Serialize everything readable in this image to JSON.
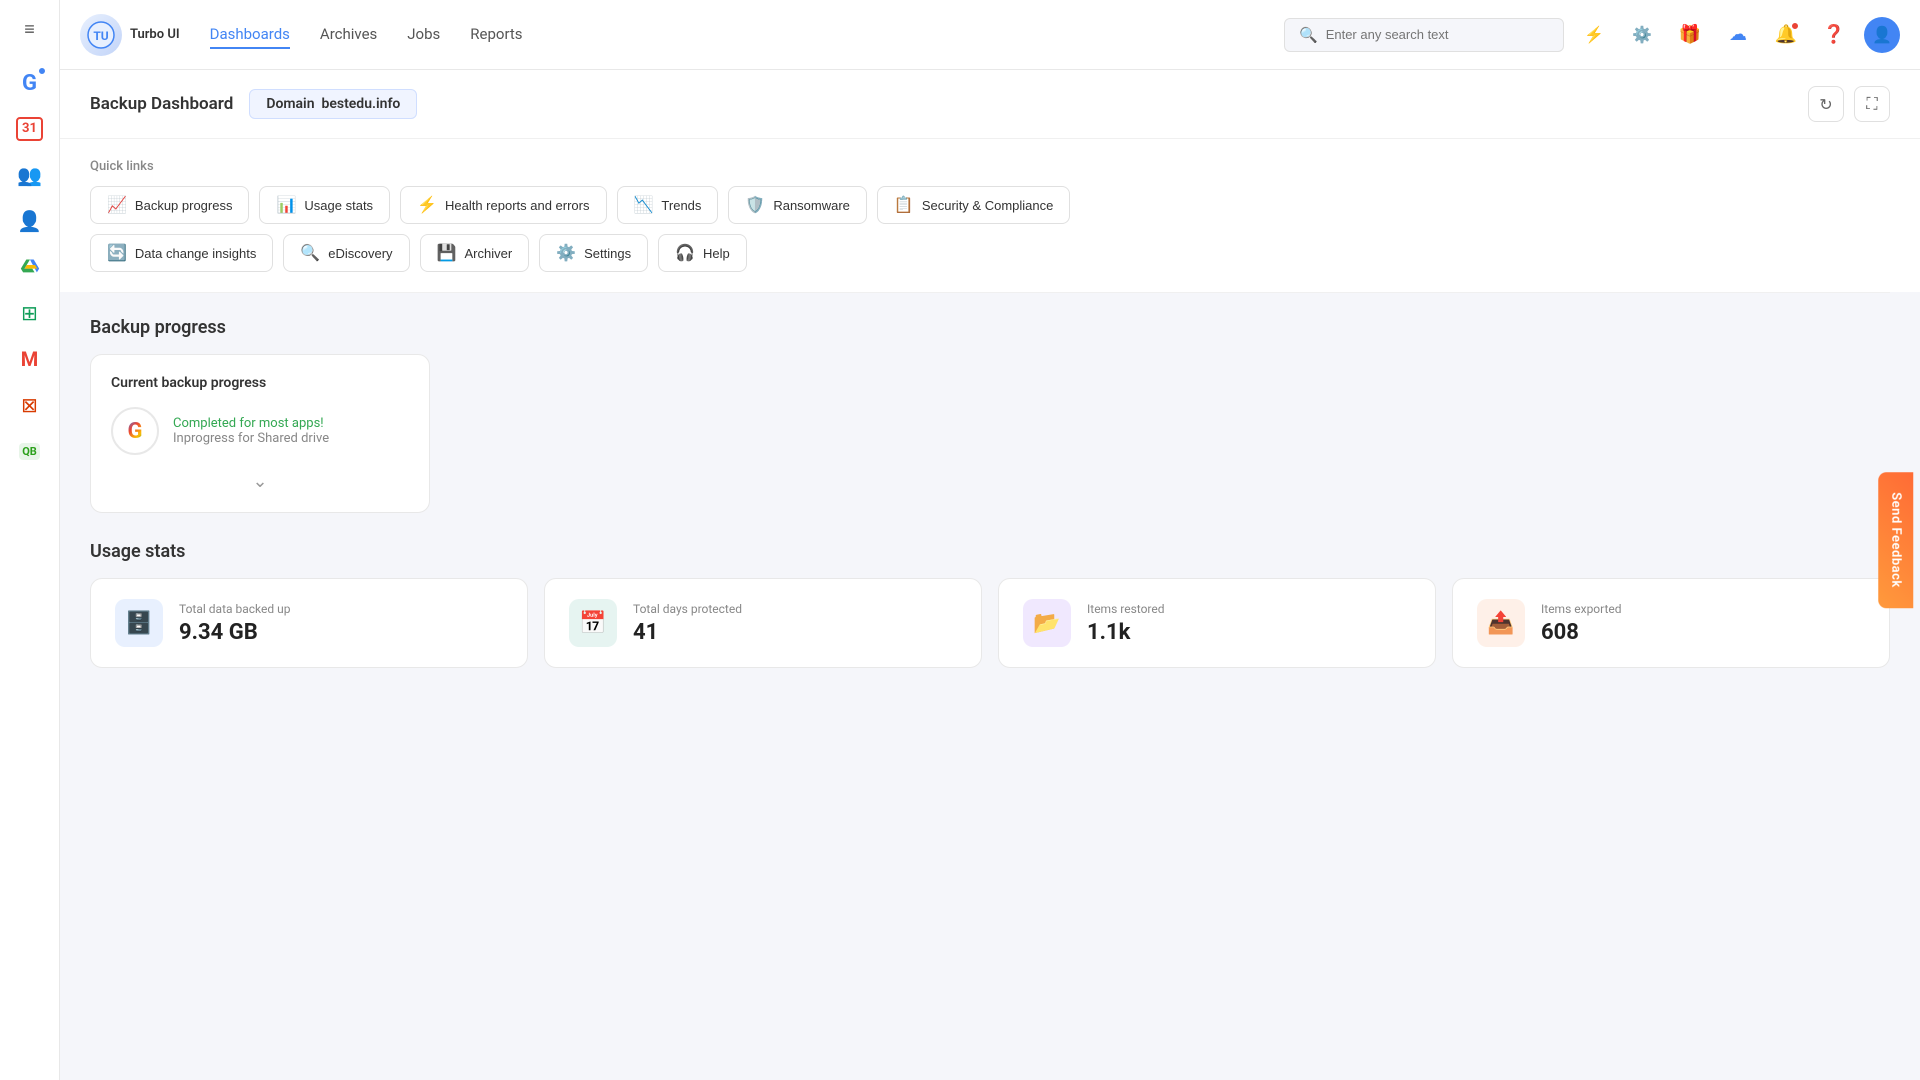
{
  "app": {
    "name": "Turbo UI"
  },
  "navbar": {
    "links": [
      {
        "id": "dashboards",
        "label": "Dashboards",
        "active": true
      },
      {
        "id": "archives",
        "label": "Archives",
        "active": false
      },
      {
        "id": "jobs",
        "label": "Jobs",
        "active": false
      },
      {
        "id": "reports",
        "label": "Reports",
        "active": false
      }
    ],
    "search_placeholder": "Enter any search text"
  },
  "page_header": {
    "title": "Backup Dashboard",
    "domain_label": "Domain",
    "domain_value": "bestedu.info"
  },
  "quick_links": {
    "label": "Quick links",
    "row1": [
      {
        "id": "backup-progress",
        "label": "Backup progress",
        "icon": "📈"
      },
      {
        "id": "usage-stats",
        "label": "Usage stats",
        "icon": "📊"
      },
      {
        "id": "health-reports",
        "label": "Health reports and errors",
        "icon": "⚡"
      },
      {
        "id": "trends",
        "label": "Trends",
        "icon": "📉"
      },
      {
        "id": "ransomware",
        "label": "Ransomware",
        "icon": "🛡️"
      },
      {
        "id": "security",
        "label": "Security & Compliance",
        "icon": "📋"
      }
    ],
    "row2": [
      {
        "id": "data-change",
        "label": "Data change insights",
        "icon": "🔄"
      },
      {
        "id": "ediscovery",
        "label": "eDiscovery",
        "icon": "🔍"
      },
      {
        "id": "archiver",
        "label": "Archiver",
        "icon": "💾"
      },
      {
        "id": "settings",
        "label": "Settings",
        "icon": "⚙️"
      },
      {
        "id": "help",
        "label": "Help",
        "icon": "🎧"
      }
    ]
  },
  "backup_progress": {
    "section_title": "Backup progress",
    "card_title": "Current backup progress",
    "apps": [
      {
        "name": "Google",
        "icon": "G",
        "status_completed": "Completed for most apps!",
        "status_inprogress": "Inprogress for Shared drive"
      }
    ]
  },
  "usage_stats": {
    "section_title": "Usage stats",
    "cards": [
      {
        "id": "total-data",
        "label": "Total data backed up",
        "value": "9.34 GB",
        "icon": "🗄️",
        "color": "blue"
      },
      {
        "id": "days-protected",
        "label": "Total days protected",
        "value": "41",
        "icon": "📅",
        "color": "teal"
      },
      {
        "id": "items-restored",
        "label": "Items restored",
        "value": "1.1k",
        "icon": "📂",
        "color": "purple"
      },
      {
        "id": "items-exported",
        "label": "Items exported",
        "value": "608",
        "icon": "📤",
        "color": "orange"
      }
    ]
  },
  "feedback": {
    "label": "Send Feedback"
  },
  "sidebar": {
    "items": [
      {
        "id": "menu",
        "icon": "≡",
        "label": "Menu"
      },
      {
        "id": "google",
        "icon": "G",
        "label": "Google",
        "badge": true
      },
      {
        "id": "calendar",
        "icon": "31",
        "label": "Calendar"
      },
      {
        "id": "contacts",
        "icon": "👥",
        "label": "Contacts"
      },
      {
        "id": "user",
        "icon": "👤",
        "label": "User"
      },
      {
        "id": "drive",
        "icon": "△",
        "label": "Drive"
      },
      {
        "id": "sheets",
        "icon": "⊞",
        "label": "Sheets"
      },
      {
        "id": "gmail",
        "icon": "M",
        "label": "Gmail"
      },
      {
        "id": "office",
        "icon": "⊠",
        "label": "Office"
      },
      {
        "id": "quickbooks",
        "icon": "QB",
        "label": "QuickBooks"
      }
    ]
  }
}
